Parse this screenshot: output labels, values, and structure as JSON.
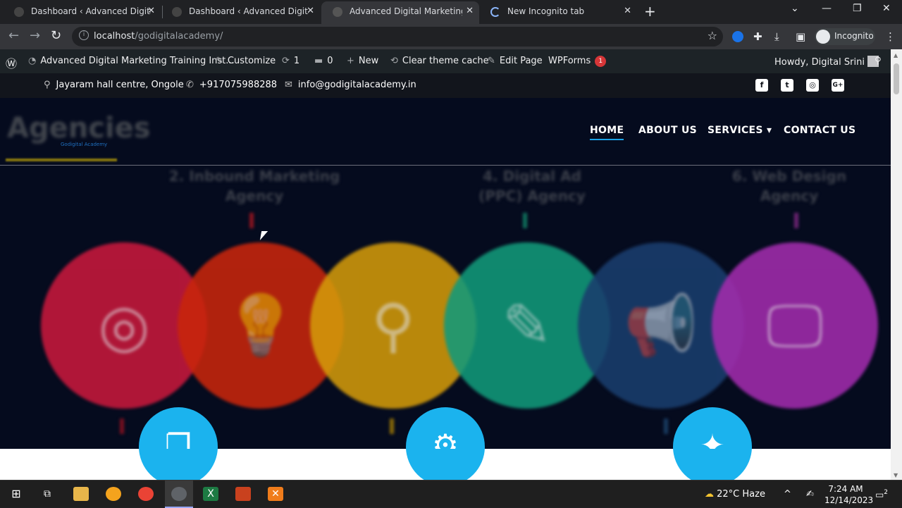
{
  "browser": {
    "tabs": [
      {
        "title": "Dashboard ‹ Advanced Digital Marketing",
        "active": false
      },
      {
        "title": "Dashboard ‹ Advanced Digital Marketing",
        "active": false
      },
      {
        "title": "Advanced Digital Marketing Training",
        "active": true
      },
      {
        "title": "New Incognito tab",
        "active": false
      }
    ],
    "close_glyph": "✕",
    "new_tab_glyph": "+",
    "url_host": "localhost",
    "url_path": "/godigitalacademy/",
    "profile_label": "Incognito"
  },
  "wp_admin_bar": {
    "site_name": "Advanced Digital Marketing Training Inst...",
    "customize": "Customize",
    "updates_count": "1",
    "comments_count": "0",
    "new": "New",
    "clear_cache": "Clear theme cache",
    "edit_page": "Edit Page",
    "wpforms": "WPForms",
    "wpforms_badge": "1",
    "howdy": "Howdy, Digital Srini"
  },
  "site": {
    "topbar": {
      "address": "Jayaram hall centre, Ongole",
      "phone": "+917075988288",
      "email": "info@godigitalacademy.in"
    },
    "social": [
      {
        "name": "facebook-icon",
        "glyph": "f"
      },
      {
        "name": "twitter-icon",
        "glyph": "t"
      },
      {
        "name": "instagram-icon",
        "glyph": "◎"
      },
      {
        "name": "google-plus-icon",
        "glyph": "G+"
      }
    ],
    "logo_text": "Agencies",
    "logo_sub": "Godigital Academy",
    "nav": [
      {
        "label": "HOME",
        "active": true
      },
      {
        "label": "ABOUT US",
        "active": false
      },
      {
        "label": "SERVICES ▾",
        "active": false
      },
      {
        "label": "CONTACT US",
        "active": false
      }
    ],
    "hero": {
      "labels": [
        {
          "line1": "2. Inbound Marketing",
          "line2": "Agency"
        },
        {
          "line1": "4. Digital Ad",
          "line2": "(PPC) Agency"
        },
        {
          "line1": "6. Web Design",
          "line2": "Agency"
        }
      ],
      "circles": [
        {
          "color": "#c8183c",
          "icon": "target-icon",
          "glyph": "◎"
        },
        {
          "color": "#c9260c",
          "icon": "lightbulb-icon",
          "glyph": "💡"
        },
        {
          "color": "#d39a0a",
          "icon": "magnifier-icon",
          "glyph": "⚲"
        },
        {
          "color": "#129a7a",
          "icon": "pencil-icon",
          "glyph": "✎"
        },
        {
          "color": "#1a3e6e",
          "icon": "megaphone-icon",
          "glyph": "📢"
        },
        {
          "color": "#a22cad",
          "icon": "monitor-pen-icon",
          "glyph": "🖵"
        }
      ],
      "bubbles": [
        {
          "icon": "copy-icon",
          "glyph": "❐"
        },
        {
          "icon": "gears-icon",
          "glyph": "⚙"
        },
        {
          "icon": "magic-wand-icon",
          "glyph": "✦"
        }
      ]
    }
  },
  "taskbar": {
    "weather": "22°C  Haze",
    "time": "7:24 AM",
    "date": "12/14/2023",
    "notification_count": "2"
  }
}
